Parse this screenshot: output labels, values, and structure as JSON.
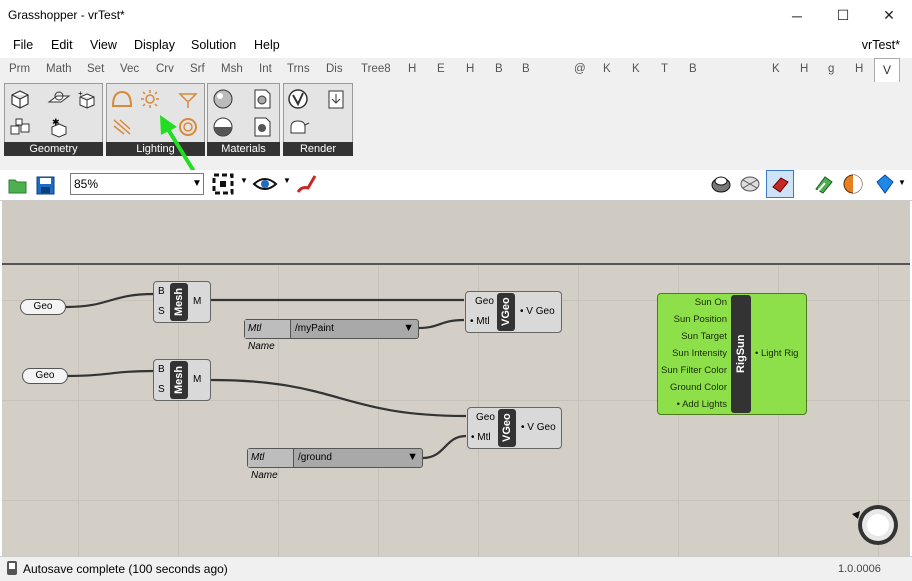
{
  "window": {
    "title": "Grasshopper - vrTest*",
    "doc_name": "vrTest*",
    "controls": {
      "minimize": "─",
      "maximize": "☐",
      "close": "✕"
    }
  },
  "menu": [
    "File",
    "Edit",
    "View",
    "Display",
    "Solution",
    "Help"
  ],
  "tabs": [
    "Prm",
    "Math",
    "Set",
    "Vec",
    "Crv",
    "Srf",
    "Msh",
    "Int",
    "Trns",
    "Dis",
    "Tree8",
    "H",
    "E",
    "H",
    "B",
    "B",
    "@",
    "K",
    "K",
    "T",
    "B",
    "K",
    "H",
    "g",
    "H",
    "V"
  ],
  "ribbon": {
    "groups": [
      "Geometry",
      "Lighting",
      "Materials",
      "Render"
    ],
    "accent_color": "#d88a3b",
    "arrow_color": "#22dd22"
  },
  "toolbar": {
    "zoom": "85%"
  },
  "canvas": {
    "geo_params": [
      "Geo",
      "Geo"
    ],
    "mesh_components": [
      {
        "name": "Mesh",
        "inputs": [
          "B",
          "S"
        ],
        "output": "M"
      },
      {
        "name": "Mesh",
        "inputs": [
          "B",
          "S"
        ],
        "output": "M"
      }
    ],
    "value_lists": [
      {
        "key": "Mtl Name",
        "value": "/myPaint"
      },
      {
        "key": "Mtl Name",
        "value": "/ground"
      }
    ],
    "vgeo_components": [
      {
        "name": "VGeo",
        "inputs": [
          "Geo",
          "• Mtl"
        ],
        "output": "• V Geo"
      },
      {
        "name": "VGeo",
        "inputs": [
          "Geo",
          "• Mtl"
        ],
        "output": "• V Geo"
      }
    ],
    "rigsun": {
      "name": "RigSun",
      "inputs": [
        "Sun On",
        "Sun Position",
        "Sun Target",
        "Sun Intensity",
        "Sun Filter Color",
        "Ground Color",
        "• Add Lights"
      ],
      "output": "• Light Rig",
      "color": "#8ee04a"
    }
  },
  "status": {
    "message": "Autosave complete (100 seconds ago)",
    "version": "1.0.0006"
  }
}
